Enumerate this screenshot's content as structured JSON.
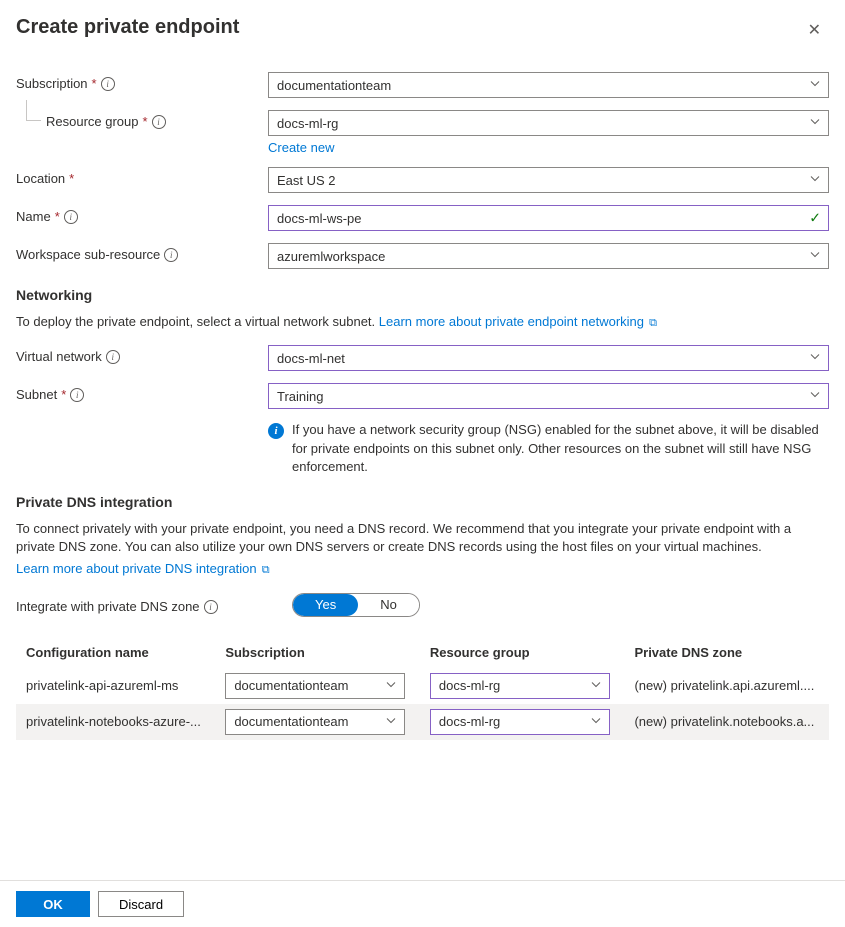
{
  "header": {
    "title": "Create private endpoint"
  },
  "form": {
    "subscription": {
      "label": "Subscription",
      "value": "documentationteam"
    },
    "resourceGroup": {
      "label": "Resource group",
      "value": "docs-ml-rg",
      "createNew": "Create new"
    },
    "location": {
      "label": "Location",
      "value": "East US 2"
    },
    "name": {
      "label": "Name",
      "value": "docs-ml-ws-pe"
    },
    "subResource": {
      "label": "Workspace sub-resource",
      "value": "azuremlworkspace"
    }
  },
  "networking": {
    "heading": "Networking",
    "desc": "To deploy the private endpoint, select a virtual network subnet. ",
    "learnMore": "Learn more about private endpoint networking",
    "vnet": {
      "label": "Virtual network",
      "value": "docs-ml-net"
    },
    "subnet": {
      "label": "Subnet",
      "value": "Training"
    },
    "nsgNote": "If you have a network security group (NSG) enabled for the subnet above, it will be disabled for private endpoints on this subnet only. Other resources on the subnet will still have NSG enforcement."
  },
  "dns": {
    "heading": "Private DNS integration",
    "desc": "To connect privately with your private endpoint, you need a DNS record. We recommend that you integrate your private endpoint with a private DNS zone. You can also utilize your own DNS servers or create DNS records using the host files on your virtual machines.",
    "learnMore": "Learn more about private DNS integration",
    "toggle": {
      "label": "Integrate with private DNS zone",
      "yes": "Yes",
      "no": "No"
    },
    "columns": {
      "config": "Configuration name",
      "sub": "Subscription",
      "rg": "Resource group",
      "zone": "Private DNS zone"
    },
    "rows": [
      {
        "config": "privatelink-api-azureml-ms",
        "sub": "documentationteam",
        "rg": "docs-ml-rg",
        "zone": "(new) privatelink.api.azureml...."
      },
      {
        "config": "privatelink-notebooks-azure-...",
        "sub": "documentationteam",
        "rg": "docs-ml-rg",
        "zone": "(new) privatelink.notebooks.a..."
      }
    ]
  },
  "footer": {
    "ok": "OK",
    "discard": "Discard"
  }
}
